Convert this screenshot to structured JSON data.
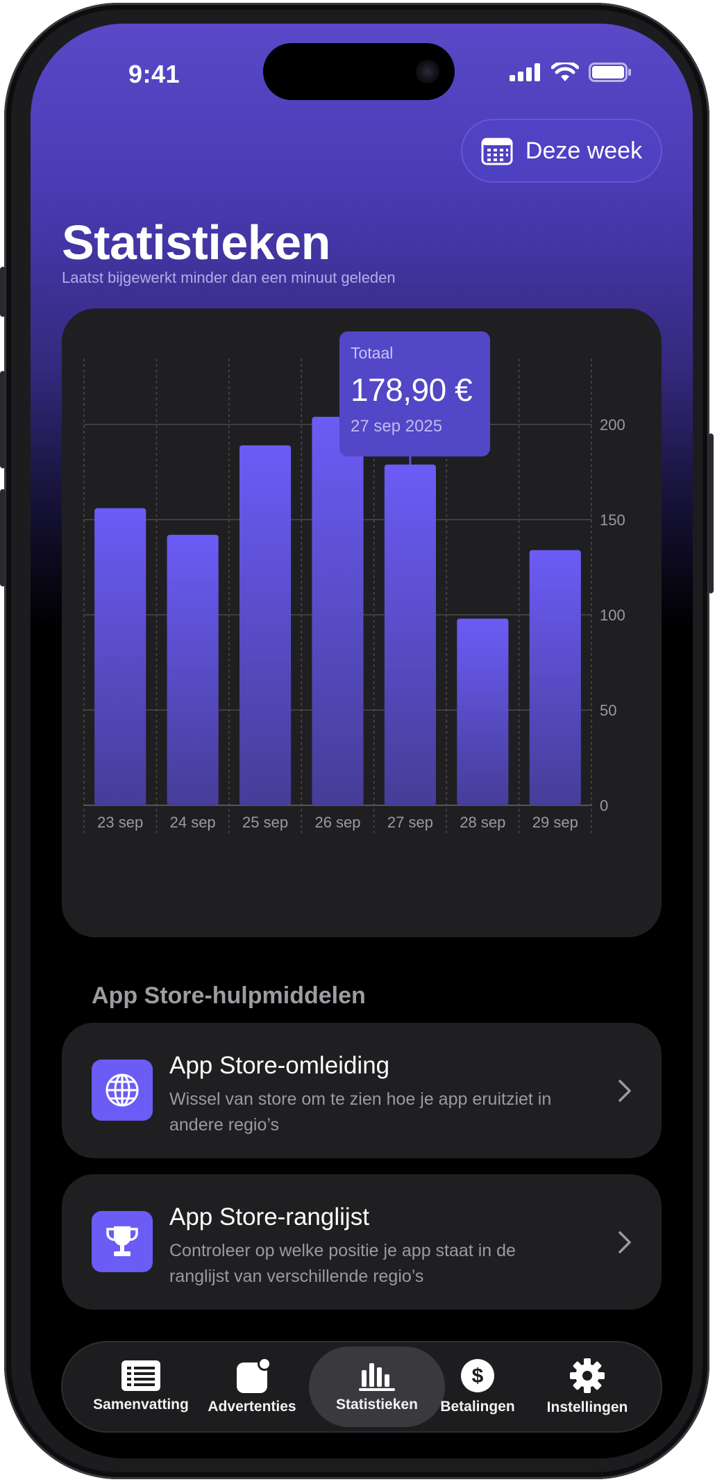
{
  "status_bar": {
    "time": "9:41"
  },
  "header": {
    "range_button": "Deze week",
    "title": "Statistieken",
    "subtitle": "Laatst bijgewerkt minder dan een minuut geleden"
  },
  "tooltip": {
    "label": "Totaal",
    "value": "178,90 €",
    "date": "27 sep 2025"
  },
  "chart_data": {
    "type": "bar",
    "categories": [
      "23 sep",
      "24 sep",
      "25 sep",
      "26 sep",
      "27 sep",
      "28 sep",
      "29 sep"
    ],
    "values": [
      156,
      142,
      189,
      204,
      178.9,
      98,
      134
    ],
    "ylim": [
      0,
      220
    ],
    "yticks": [
      "0",
      "50",
      "100",
      "150",
      "200"
    ],
    "ytick_values": [
      0,
      50,
      100,
      150,
      200
    ],
    "selected_index": 4,
    "bar_color": "#6b5cf6",
    "grid": true
  },
  "tools": {
    "section_title": "App Store-hulpmiddelen",
    "items": [
      {
        "title": "App Store-omleiding",
        "desc": "Wissel van store om te zien hoe je app eruitziet in andere regio’s",
        "icon": "globe-icon"
      },
      {
        "title": "App Store-ranglijst",
        "desc": "Controleer op welke positie je app staat in de ranglijst van verschillende regio’s",
        "icon": "trophy-icon"
      }
    ]
  },
  "tabbar": {
    "items": [
      {
        "label": "Samenvatting",
        "icon": "list-icon"
      },
      {
        "label": "Advertenties",
        "icon": "app-badge-icon"
      },
      {
        "label": "Statistieken",
        "icon": "bar-chart-icon",
        "active": true
      },
      {
        "label": "Betalingen",
        "icon": "dollar-icon"
      },
      {
        "label": "Instellingen",
        "icon": "gear-icon"
      }
    ]
  },
  "colors": {
    "accent": "#6b5cf6",
    "card": "#1f1f21"
  }
}
